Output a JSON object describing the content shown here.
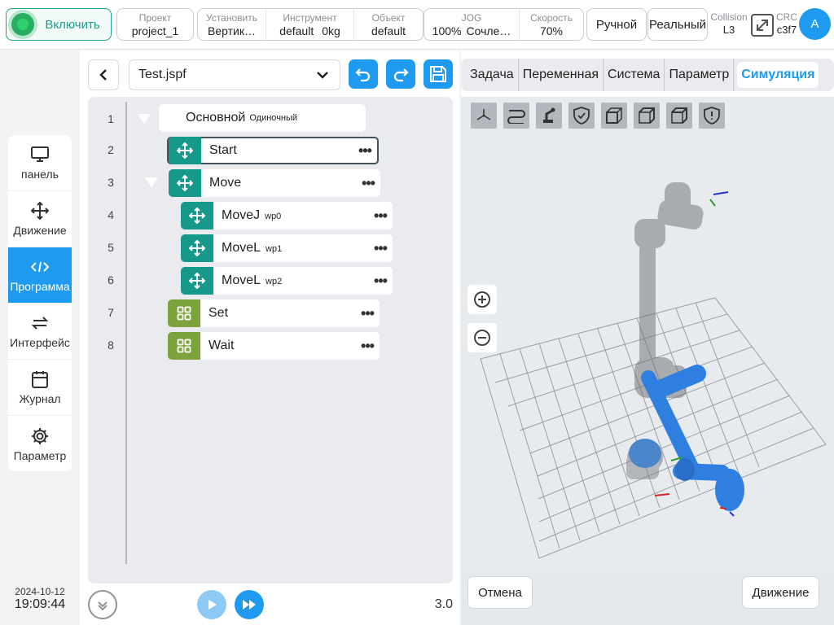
{
  "topbar": {
    "power_label": "Включить",
    "project": {
      "label": "Проект",
      "value": "project_1"
    },
    "install": {
      "label": "Установить",
      "value": "Вертик…"
    },
    "tool": {
      "label": "Инструмент",
      "value": "default",
      "load": "0kg"
    },
    "object": {
      "label": "Объект",
      "value": "default"
    },
    "jog": {
      "label": "JOG",
      "percent": "100%",
      "mode": "Сочле…"
    },
    "speed": {
      "label": "Скорость",
      "value": "70%"
    },
    "manual_label": "Ручной",
    "real_label": "Реальный",
    "collision": {
      "label": "Collision",
      "value": "L3"
    },
    "crc": {
      "label": "CRC",
      "value": "c3f7"
    },
    "avatar_letter": "A"
  },
  "sidenav": {
    "items": [
      {
        "label": "панель",
        "icon": "monitor-icon"
      },
      {
        "label": "Движение",
        "icon": "move-arrows-icon"
      },
      {
        "label": "Программа",
        "icon": "code-icon"
      },
      {
        "label": "Интерфейс",
        "icon": "swap-icon"
      },
      {
        "label": "Журнал",
        "icon": "calendar-icon"
      },
      {
        "label": "Параметр",
        "icon": "gear-icon"
      }
    ],
    "active": "Программа"
  },
  "datetime": {
    "date": "2024-10-12",
    "time": "19:09:44"
  },
  "program": {
    "file_name": "Test.jspf",
    "line_numbers": [
      "1",
      "2",
      "3",
      "4",
      "5",
      "6",
      "7",
      "8"
    ],
    "main": {
      "label": "Основной",
      "sub": "Одиночный"
    },
    "nodes": [
      {
        "label": "Start",
        "sub": "",
        "type": "move"
      },
      {
        "label": "Move",
        "sub": "",
        "type": "move"
      },
      {
        "label": "MoveJ",
        "sub": "wp0",
        "type": "move"
      },
      {
        "label": "MoveL",
        "sub": "wp1",
        "type": "move"
      },
      {
        "label": "MoveL",
        "sub": "wp2",
        "type": "move"
      },
      {
        "label": "Set",
        "sub": "",
        "type": "logic"
      },
      {
        "label": "Wait",
        "sub": "",
        "type": "logic"
      }
    ],
    "version": "3.0"
  },
  "right_panel": {
    "tabs": [
      "Задача",
      "Переменная",
      "Система",
      "Параметр",
      "Симуляция"
    ],
    "active_tab": "Симуляция",
    "view_buttons": [
      "axes-view-icon",
      "path-icon",
      "robot-view-icon",
      "shield-check-icon",
      "cube-front-icon",
      "cube-side-icon",
      "cube-top-icon",
      "shield-alert-icon"
    ],
    "cancel_label": "Отмена",
    "move_label": "Движение"
  },
  "colors": {
    "accent": "#1e9bf0",
    "teal": "#16998a",
    "olive": "#7ca33c",
    "power": "#27ae60"
  }
}
